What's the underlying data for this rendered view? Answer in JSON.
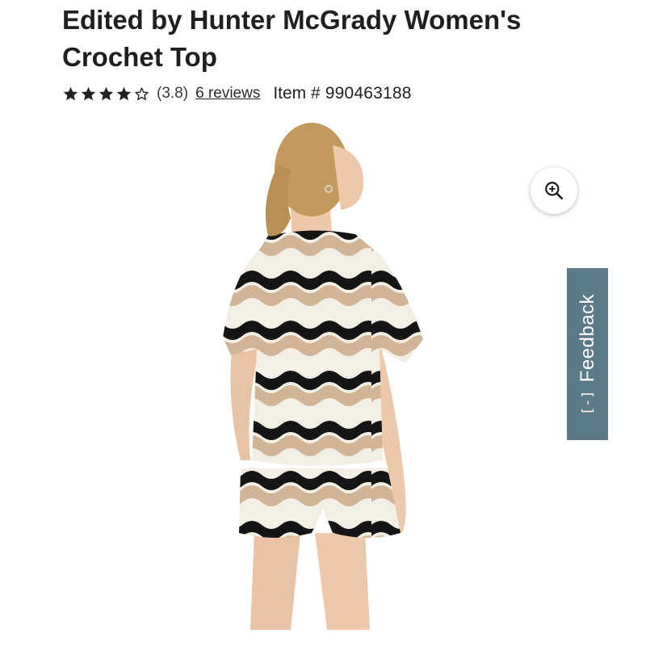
{
  "product": {
    "title": "Edited by Hunter McGrady Women's Crochet Top",
    "rating": 3.8,
    "rating_text": "(3.8)",
    "reviews_text": "6 reviews",
    "item_label": "Item #",
    "item_number": "990463188"
  },
  "rating_stars": [
    "full",
    "full",
    "full",
    "full",
    "empty"
  ],
  "feedback": {
    "label": "Feedback",
    "icon_text": "[-]"
  },
  "colors": {
    "feedback_bg": "#5c7b8a",
    "stripe_black": "#151515",
    "stripe_tan": "#d2b596",
    "stripe_cream": "#f4efe5",
    "hair": "#c29a5d",
    "skin": "#edc8aa"
  },
  "icons": {
    "zoom": "zoom-in-icon",
    "star_full": "star-filled-icon",
    "star_empty": "star-outline-icon"
  }
}
